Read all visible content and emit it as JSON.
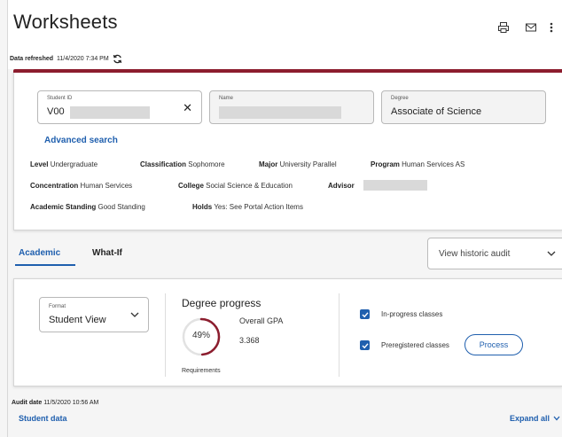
{
  "header": {
    "title": "Worksheets",
    "refresh_label": "Data refreshed",
    "refresh_time": "11/4/2020 7:34 PM"
  },
  "student": {
    "id_label": "Student ID",
    "id_value": "V00",
    "name_label": "Name",
    "name_value": "",
    "degree_label": "Degree",
    "degree_value": "Associate of Science",
    "clear_symbol": "✕",
    "advanced_search": "Advanced search"
  },
  "details": {
    "level_label": "Level",
    "level_value": "Undergraduate",
    "classification_label": "Classification",
    "classification_value": "Sophomore",
    "major_label": "Major",
    "major_value": "University Parallel",
    "program_label": "Program",
    "program_value": "Human Services AS",
    "concentration_label": "Concentration",
    "concentration_value": "Human Services",
    "college_label": "College",
    "college_value": "Social Science & Education",
    "advisor_label": "Advisor",
    "advisor_value": "",
    "standing_label": "Academic Standing",
    "standing_value": "Good Standing",
    "holds_label": "Holds",
    "holds_value": "Yes: See Portal Action Items"
  },
  "tabs": {
    "academic": "Academic",
    "whatif": "What-If",
    "historic_placeholder": "View historic audit"
  },
  "audit": {
    "format_label": "Format",
    "format_value": "Student View",
    "progress_title": "Degree progress",
    "progress_percent_text": "49%",
    "progress_fraction": 0.49,
    "gpa_label": "Overall GPA",
    "gpa_value": "3.368",
    "requirements_label": "Requirements",
    "inprogress_label": "In-progress classes",
    "inprogress_checked": true,
    "preregistered_label": "Preregistered classes",
    "preregistered_checked": true,
    "process_button": "Process"
  },
  "footer": {
    "audit_date_label": "Audit date",
    "audit_date_value": "11/5/2020 10:56 AM",
    "student_data": "Student data",
    "expand_all": "Expand all"
  },
  "colors": {
    "accent": "#8c1d2e",
    "link": "#1f5fae",
    "progress_ring": "#8c1d2e"
  }
}
